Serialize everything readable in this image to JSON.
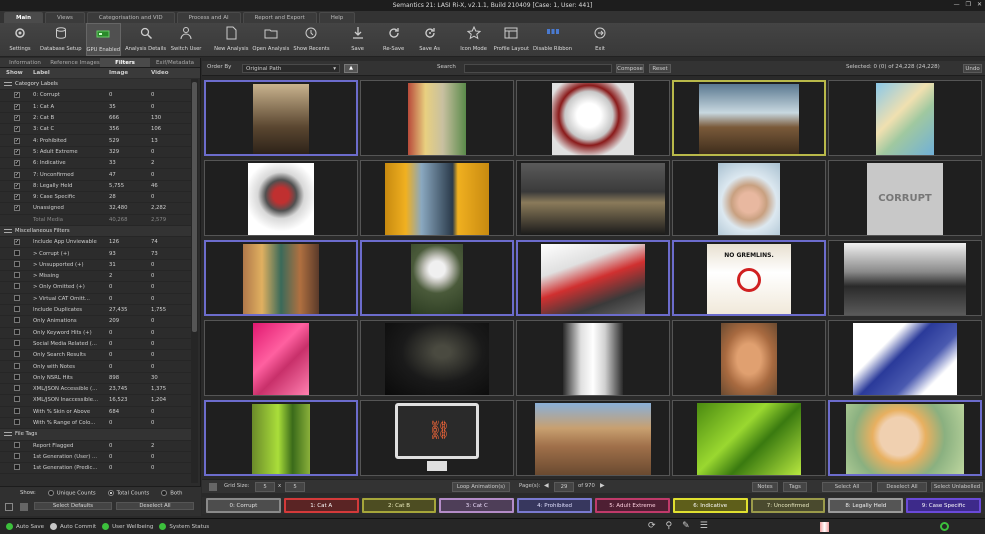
{
  "title": "Semantics 21: LASI Ri-X, v2.1.1, Build 210409     [Case: 1, User: 441]",
  "menu_tabs": [
    "Main",
    "Views",
    "Categorisation and VID",
    "Process and AI",
    "Report and Export",
    "Help"
  ],
  "ribbon": [
    {
      "label": "Settings",
      "icon": "gear-icon"
    },
    {
      "label": "Database Setup",
      "icon": "database-icon"
    },
    {
      "label": "GPU Enabled",
      "icon": "gpu-icon"
    },
    {
      "label": "Analysis Details",
      "icon": "analysis-icon"
    },
    {
      "label": "Switch User",
      "icon": "user-icon"
    },
    {
      "label": "New Analysis",
      "icon": "new-file-icon"
    },
    {
      "label": "Open Analysis",
      "icon": "folder-open-icon"
    },
    {
      "label": "Show Recents",
      "icon": "history-icon"
    },
    {
      "label": "Save",
      "icon": "save-icon"
    },
    {
      "label": "Re-Save",
      "icon": "resave-icon"
    },
    {
      "label": "Save As",
      "icon": "save-as-icon"
    },
    {
      "label": "Icon Mode",
      "icon": "star-icon"
    },
    {
      "label": "Profile Layout",
      "icon": "layout-icon"
    },
    {
      "label": "Disable Ribbon",
      "icon": "ribbon-icon"
    },
    {
      "label": "Exit",
      "icon": "exit-icon"
    }
  ],
  "left_tabs": [
    "Information",
    "Reference Images",
    "Filters",
    "Exif/Metadata"
  ],
  "left_headers": {
    "show": "Show",
    "label": "Label",
    "image": "Image",
    "video": "Video"
  },
  "left_rows": [
    {
      "type": "group",
      "label": "Category Labels"
    },
    {
      "chk": true,
      "label": "0: Corrupt",
      "image": "0",
      "video": "0"
    },
    {
      "chk": true,
      "label": "1: Cat A",
      "image": "35",
      "video": "0"
    },
    {
      "chk": true,
      "label": "2: Cat B",
      "image": "666",
      "video": "130"
    },
    {
      "chk": true,
      "label": "3: Cat C",
      "image": "356",
      "video": "106"
    },
    {
      "chk": true,
      "label": "4: Prohibited",
      "image": "529",
      "video": "13"
    },
    {
      "chk": true,
      "label": "5: Adult Extreme",
      "image": "329",
      "video": "0"
    },
    {
      "chk": true,
      "label": "6: Indicative",
      "image": "33",
      "video": "2"
    },
    {
      "chk": true,
      "label": "7: Unconfirmed",
      "image": "47",
      "video": "0"
    },
    {
      "chk": true,
      "label": "8: Legally Held",
      "image": "5,755",
      "video": "46"
    },
    {
      "chk": true,
      "label": "9: Case Specific",
      "image": "28",
      "video": "0"
    },
    {
      "chk": true,
      "label": "Unassigned",
      "image": "32,480",
      "video": "2,282"
    },
    {
      "dim": true,
      "label": "Total Media",
      "image": "40,268",
      "video": "2,579"
    },
    {
      "type": "group",
      "label": "Miscellaneous Filters"
    },
    {
      "chk": true,
      "label": "Include App Unviewable",
      "image": "126",
      "video": "74"
    },
    {
      "chk": false,
      "label": "  > Corrupt (+)",
      "image": "93",
      "video": "73"
    },
    {
      "chk": false,
      "label": "  > Unsupported (+)",
      "image": "31",
      "video": "0"
    },
    {
      "chk": false,
      "label": "  > Missing",
      "image": "2",
      "video": "0"
    },
    {
      "chk": false,
      "label": "  > Only Omitted (+)",
      "image": "0",
      "video": "0"
    },
    {
      "chk": false,
      "label": "  > Virtual CAT Omitt...",
      "image": "0",
      "video": "0"
    },
    {
      "chk": false,
      "label": "Include Duplicates",
      "image": "27,435",
      "video": "1,755"
    },
    {
      "chk": false,
      "label": "Only Animations",
      "image": "209",
      "video": "0"
    },
    {
      "chk": false,
      "label": "Only Keyword Hits (+)",
      "image": "0",
      "video": "0"
    },
    {
      "chk": false,
      "label": "Social Media Related (...",
      "image": "0",
      "video": "0"
    },
    {
      "chk": false,
      "label": "Only Search Results",
      "image": "0",
      "video": "0"
    },
    {
      "chk": false,
      "label": "Only with Notes",
      "image": "0",
      "video": "0"
    },
    {
      "chk": false,
      "label": "Only NSRL Hits",
      "image": "898",
      "video": "30"
    },
    {
      "chk": false,
      "label": "XML/JSON Accessible (...",
      "image": "23,745",
      "video": "1,375"
    },
    {
      "chk": false,
      "label": "XML/JSON Inaccessible...",
      "image": "16,523",
      "video": "1,204"
    },
    {
      "chk": false,
      "label": "With % Skin or Above",
      "image": "684",
      "video": "0"
    },
    {
      "chk": false,
      "label": "With % Range of Colo...",
      "image": "0",
      "video": "0"
    },
    {
      "type": "group",
      "label": "File Tags"
    },
    {
      "chk": false,
      "label": "Report Flagged",
      "image": "0",
      "video": "2"
    },
    {
      "chk": false,
      "label": "1st Generation (User) ...",
      "image": "0",
      "video": "0"
    },
    {
      "chk": false,
      "label": "1st Generation (Predic...",
      "image": "0",
      "video": "0"
    }
  ],
  "left_footer": {
    "show_label": "Show:",
    "radios": [
      "Unique Counts",
      "Total Counts",
      "Both"
    ],
    "selected": "Total Counts",
    "select_defaults": "Select Defaults",
    "deselect_all": "Deselect All"
  },
  "toolbar": {
    "order_by": "Order By",
    "order_value": "Original Path",
    "search": "Search",
    "compose": "Compose",
    "reset": "Reset",
    "selected": "Selected: 0 (0) of 24,228 (24,228)",
    "undo": "Undo"
  },
  "grid_footer": {
    "grid_size": "Grid Size:",
    "cols": "5",
    "x": "x",
    "rows": "5",
    "loop": "Loop Animation(s)",
    "pages": "Page(s):",
    "page": "29",
    "of": "of 970",
    "notes": "Notes",
    "tags": "Tags",
    "select_all": "Select All",
    "deselect_all": "Deselect All",
    "select_unlabelled": "Select Unlabelled"
  },
  "corrupt_text": "CORRUPT",
  "nogremlins": "NO GREMLINS.",
  "categories": [
    {
      "label": "0: Corrupt",
      "color": "#8a8a8a",
      "bg": "#4d4d4d",
      "fg": "#e0e0e0"
    },
    {
      "label": "1: Cat A",
      "color": "#d43a3a",
      "bg": "#5a2424",
      "fg": "#ffffff"
    },
    {
      "label": "2: Cat B",
      "color": "#a6a63a",
      "bg": "#4d4d22",
      "fg": "#f0f0c0"
    },
    {
      "label": "3: Cat C",
      "color": "#b48cc8",
      "bg": "#4e3e58",
      "fg": "#f0e0ff"
    },
    {
      "label": "4: Prohibited",
      "color": "#7a7ad0",
      "bg": "#37375e",
      "fg": "#e0e0ff"
    },
    {
      "label": "5: Adult Extreme",
      "color": "#c03a6a",
      "bg": "#4e1f33",
      "fg": "#ffd0e0"
    },
    {
      "label": "6: Indicative",
      "color": "#e0e030",
      "bg": "#5e5e1a",
      "fg": "#ffffff"
    },
    {
      "label": "7: Unconfirmed",
      "color": "#9a9a4a",
      "bg": "#4a4a2e",
      "fg": "#e8e8c0"
    },
    {
      "label": "8: Legally Held",
      "color": "#9a9a9a",
      "bg": "#555555",
      "fg": "#f0f0f0"
    },
    {
      "label": "9: Case Specific",
      "color": "#6a4ad8",
      "bg": "#3d2a8a",
      "fg": "#ffffff"
    }
  ],
  "status": [
    {
      "label": "Auto Save",
      "color": "#3cc03c"
    },
    {
      "label": "Auto Commit",
      "color": "#c8c8c8"
    },
    {
      "label": "User Wellbeing",
      "color": "#3cc03c"
    },
    {
      "label": "System Status",
      "color": "#3cc03c"
    }
  ]
}
